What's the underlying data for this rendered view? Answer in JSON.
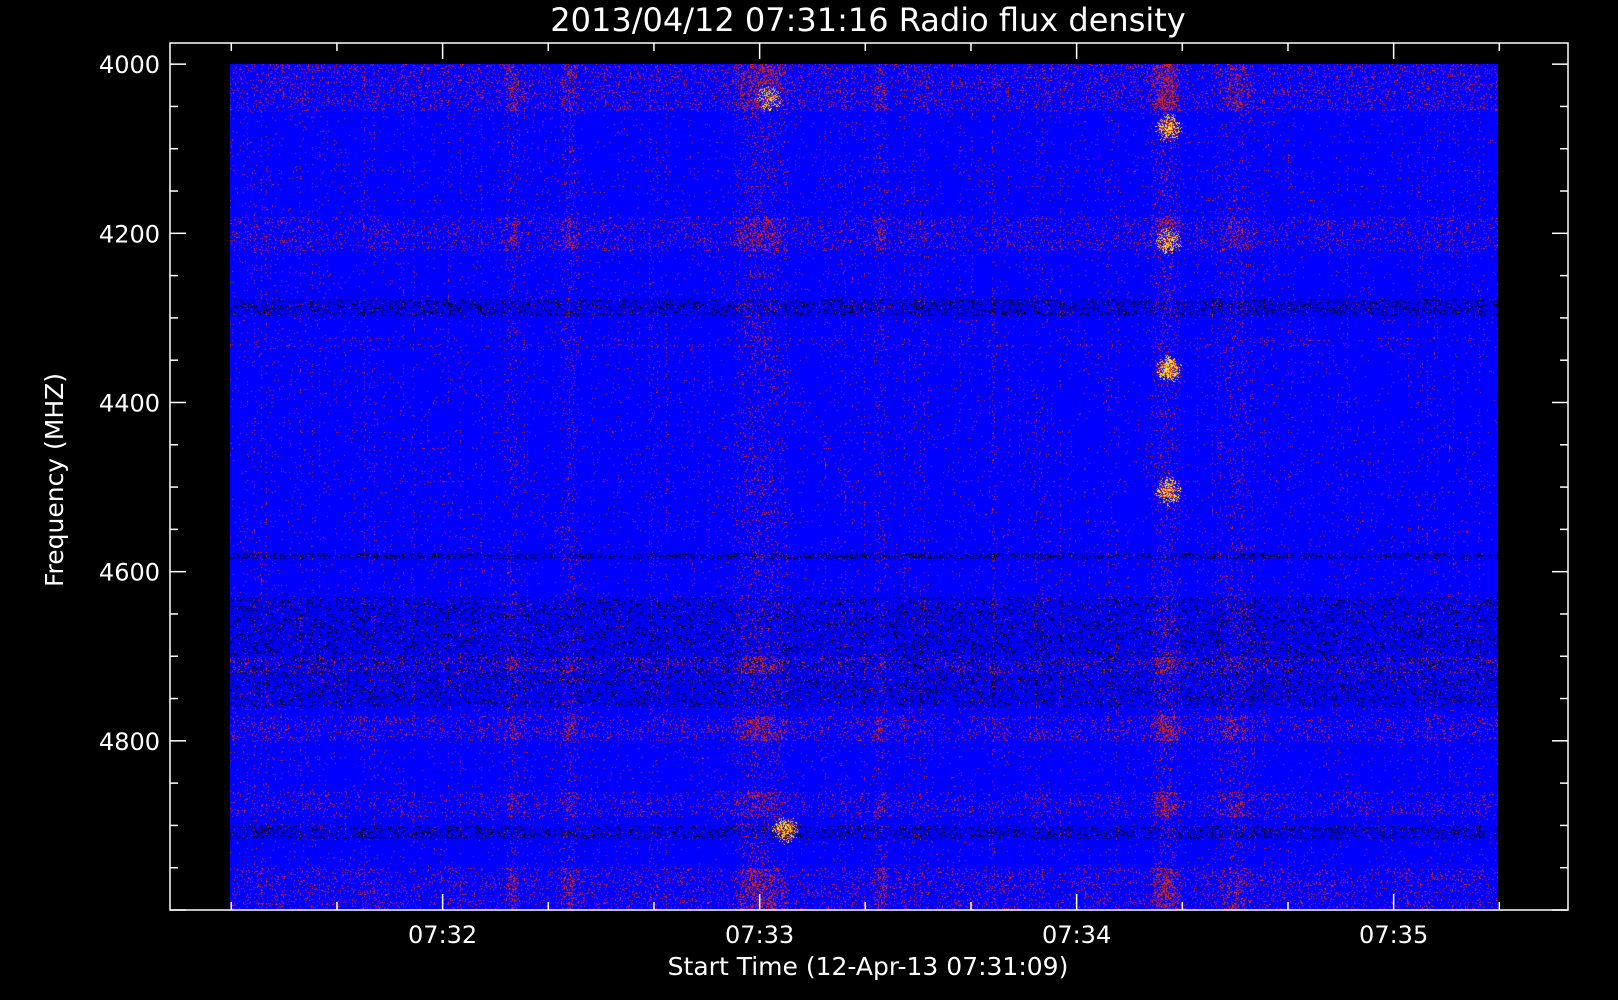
{
  "chart_data": {
    "type": "heatmap",
    "title": "2013/04/12 07:31:16 Radio flux density",
    "xlabel": "Start Time (12-Apr-13 07:31:09)",
    "ylabel": "Frequency (MHZ)",
    "x_ticks": [
      "07:32",
      "07:33",
      "07:34",
      "07:35"
    ],
    "x_tick_minutes": [
      32,
      33,
      34,
      35
    ],
    "xlim_minutes": [
      31.14,
      35.55
    ],
    "data_xlim_minutes": [
      31.33,
      35.33
    ],
    "y_ticks": [
      4000,
      4200,
      4400,
      4600,
      4800
    ],
    "ylim": [
      3975,
      5000
    ],
    "data_ylim": [
      4000,
      5000
    ],
    "y_inverted": true,
    "colormap": {
      "background": "#0000ff",
      "low": "#000000",
      "mid": "#d42a10",
      "high": "#ffe23a"
    },
    "horizontal_bands": [
      {
        "freq_range": [
          4000,
          4055
        ],
        "kind": "red",
        "strength": 0.6
      },
      {
        "freq_range": [
          4180,
          4220
        ],
        "kind": "red",
        "strength": 0.5
      },
      {
        "freq_range": [
          4277,
          4297
        ],
        "kind": "dark",
        "strength": 0.7
      },
      {
        "freq_range": [
          4578,
          4585
        ],
        "kind": "dark",
        "strength": 0.9
      },
      {
        "freq_range": [
          4630,
          4760
        ],
        "kind": "dark",
        "strength": 0.55
      },
      {
        "freq_range": [
          4700,
          4720
        ],
        "kind": "red",
        "strength": 0.45
      },
      {
        "freq_range": [
          4770,
          4800
        ],
        "kind": "red",
        "strength": 0.6
      },
      {
        "freq_range": [
          4860,
          4890
        ],
        "kind": "red",
        "strength": 0.45
      },
      {
        "freq_range": [
          4900,
          4915
        ],
        "kind": "dark",
        "strength": 0.7
      },
      {
        "freq_range": [
          4950,
          5000
        ],
        "kind": "red",
        "strength": 0.55
      }
    ],
    "vertical_bursts": [
      {
        "time_minutes": 32.22,
        "width_minutes": 0.05,
        "strength": 0.6
      },
      {
        "time_minutes": 32.4,
        "width_minutes": 0.06,
        "strength": 0.55
      },
      {
        "time_minutes": 33.0,
        "width_minutes": 0.18,
        "strength": 0.75
      },
      {
        "time_minutes": 33.38,
        "width_minutes": 0.05,
        "strength": 0.55
      },
      {
        "time_minutes": 34.28,
        "width_minutes": 0.1,
        "strength": 1.0
      },
      {
        "time_minutes": 34.5,
        "width_minutes": 0.1,
        "strength": 0.5
      }
    ],
    "hot_spots": [
      {
        "time_minutes": 34.29,
        "freq": 4360,
        "strength": 1.0
      },
      {
        "time_minutes": 34.29,
        "freq": 4505,
        "strength": 0.9
      },
      {
        "time_minutes": 34.29,
        "freq": 4210,
        "strength": 0.85
      },
      {
        "time_minutes": 34.29,
        "freq": 4075,
        "strength": 0.8
      },
      {
        "time_minutes": 33.08,
        "freq": 4905,
        "strength": 0.85
      },
      {
        "time_minutes": 33.03,
        "freq": 4040,
        "strength": 0.8
      }
    ]
  }
}
